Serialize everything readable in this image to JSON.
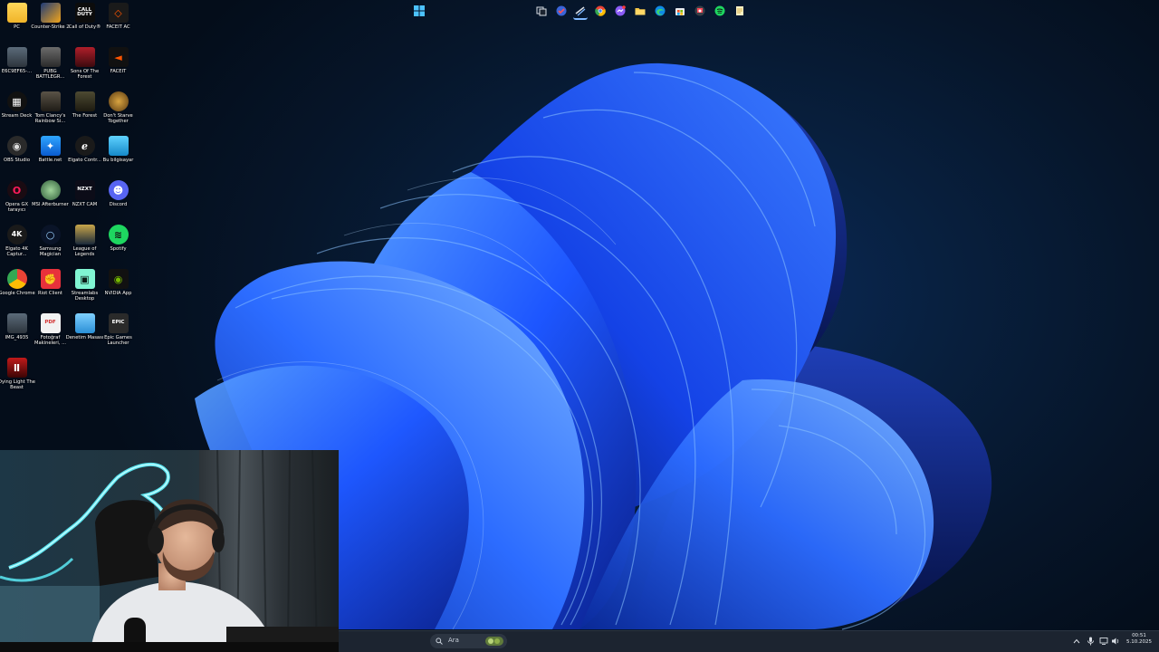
{
  "desktop_icons": [
    {
      "label": "PC",
      "icon": "folder-icon",
      "name": "desktop-icon-pc"
    },
    {
      "label": "Counter-Strike 2",
      "icon": "cs2-icon",
      "name": "desktop-icon-counter-strike-2"
    },
    {
      "label": "Call of Duty®",
      "icon": "call-of-duty-icon",
      "name": "desktop-icon-call-of-duty"
    },
    {
      "label": "FACEIT AC",
      "icon": "faceit-ac-icon",
      "name": "desktop-icon-faceit-ac"
    },
    {
      "label": "E6C9EF65-...",
      "icon": "image-file-icon",
      "name": "desktop-icon-image-file"
    },
    {
      "label": "PUBG BATTLEGR...",
      "icon": "pubg-icon",
      "name": "desktop-icon-pubg"
    },
    {
      "label": "Sons Of The Forest",
      "icon": "sons-of-the-forest-icon",
      "name": "desktop-icon-sons-of-the-forest"
    },
    {
      "label": "FACEIT",
      "icon": "faceit-icon",
      "name": "desktop-icon-faceit"
    },
    {
      "label": "Stream Deck",
      "icon": "stream-deck-icon",
      "name": "desktop-icon-stream-deck"
    },
    {
      "label": "Tom Clancy's Rainbow Si...",
      "icon": "rainbow-six-icon",
      "name": "desktop-icon-rainbow-six"
    },
    {
      "label": "The Forest",
      "icon": "the-forest-icon",
      "name": "desktop-icon-the-forest"
    },
    {
      "label": "Don't Starve Together",
      "icon": "dont-starve-icon",
      "name": "desktop-icon-dont-starve-together"
    },
    {
      "label": "OBS Studio",
      "icon": "obs-icon",
      "name": "desktop-icon-obs-studio"
    },
    {
      "label": "Battle.net",
      "icon": "battlenet-icon",
      "name": "desktop-icon-battlenet"
    },
    {
      "label": "Elgato Contr...",
      "icon": "elgato-icon",
      "name": "desktop-icon-elgato-control"
    },
    {
      "label": "Bu bilgisayar",
      "icon": "monitor-icon",
      "name": "desktop-icon-bu-bilgisayar"
    },
    {
      "label": "Opera GX tarayıcı",
      "icon": "opera-gx-icon",
      "name": "desktop-icon-opera-gx"
    },
    {
      "label": "MSI Afterburner",
      "icon": "msi-afterburner-icon",
      "name": "desktop-icon-msi-afterburner"
    },
    {
      "label": "NZXT CAM",
      "icon": "nzxt-cam-icon",
      "name": "desktop-icon-nzxt-cam"
    },
    {
      "label": "Discord",
      "icon": "discord-icon",
      "name": "desktop-icon-discord"
    },
    {
      "label": "Elgato 4K Captur...",
      "icon": "elgato-4k-icon",
      "name": "desktop-icon-elgato-4k-capture"
    },
    {
      "label": "Samsung Magician",
      "icon": "samsung-magician-icon",
      "name": "desktop-icon-samsung-magician"
    },
    {
      "label": "League of Legends",
      "icon": "league-of-legends-icon",
      "name": "desktop-icon-league-of-legends"
    },
    {
      "label": "Spotify",
      "icon": "spotify-icon",
      "name": "desktop-icon-spotify"
    },
    {
      "label": "Google Chrome",
      "icon": "chrome-icon",
      "name": "desktop-icon-google-chrome"
    },
    {
      "label": "Riot Client",
      "icon": "riot-client-icon",
      "name": "desktop-icon-riot-client"
    },
    {
      "label": "Streamlabs Desktop",
      "icon": "streamlabs-icon",
      "name": "desktop-icon-streamlabs"
    },
    {
      "label": "NVIDIA App",
      "icon": "nvidia-icon",
      "name": "desktop-icon-nvidia-app"
    },
    {
      "label": "IMG_4935",
      "icon": "image-file-icon",
      "name": "desktop-icon-img-4935"
    },
    {
      "label": "Fotoğraf Makineleri, ...",
      "icon": "pdf-icon",
      "name": "desktop-icon-fotograf-makineleri"
    },
    {
      "label": "Denetim Masası",
      "icon": "control-panel-icon",
      "name": "desktop-icon-denetim-masasi"
    },
    {
      "label": "Epic Games Launcher",
      "icon": "epic-games-icon",
      "name": "desktop-icon-epic-games"
    },
    {
      "label": "Dying Light The Beast",
      "icon": "dying-light-icon",
      "name": "desktop-icon-dying-light"
    }
  ],
  "icon_glyphs": {
    "call_of_duty": "CALL\nDUTY",
    "nzxt": "NZXT",
    "elgato_4k": "4K",
    "epic": "EPIC",
    "pdf": "PDF"
  },
  "taskbar": {
    "search_placeholder": "Ara",
    "apps": [
      "start-icon",
      "search-icon",
      "widgets-icon",
      "task-view-icon",
      "tasks-icon",
      "steam-icon",
      "chrome-icon",
      "messenger-icon",
      "file-explorer-icon",
      "edge-icon",
      "store-icon",
      "riot-icon",
      "spotify-icon",
      "notes-icon"
    ],
    "time": "00:51",
    "date": "5.10.2025"
  },
  "colors": {
    "wallpaper_bg": "#061529",
    "bloom": "#1f5cff",
    "taskbar": "#1c2430",
    "accent": "#0a84ff"
  }
}
